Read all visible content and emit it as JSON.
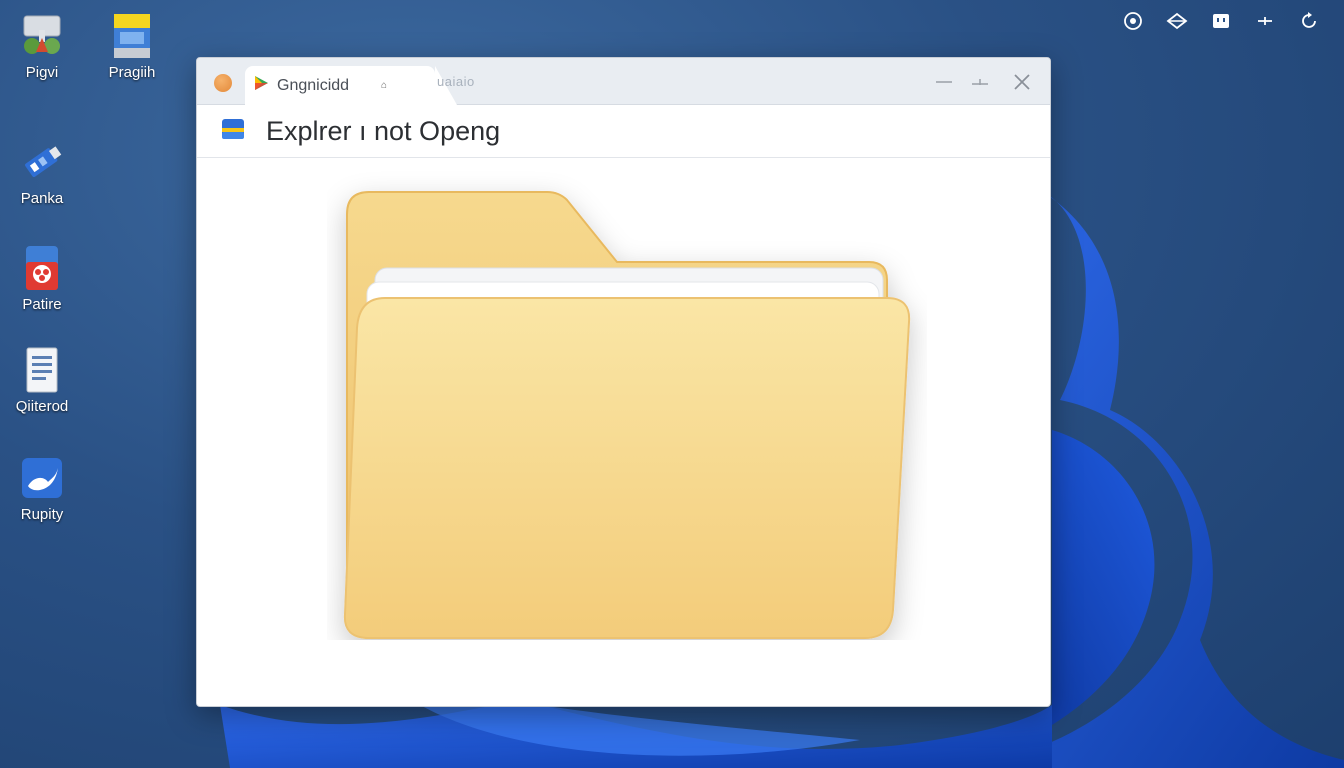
{
  "desktop": {
    "icons": [
      {
        "label": "Pigvi",
        "icon": "network-tree-icon"
      },
      {
        "label": "Pragiih",
        "icon": "app-window-icon"
      },
      {
        "label": "Panka",
        "icon": "usb-drive-icon"
      },
      {
        "label": "Patire",
        "icon": "red-app-icon"
      },
      {
        "label": "Qiiterod",
        "icon": "document-icon"
      },
      {
        "label": "Rupity",
        "icon": "blue-bird-app-icon"
      }
    ]
  },
  "tray": {
    "icons": [
      "eye-icon",
      "wifi-icon",
      "battery-icon",
      "brightness-icon",
      "refresh-icon"
    ]
  },
  "window": {
    "active_tab_title": "Gngnicidd",
    "active_tab_symbol": "⌂",
    "inactive_tab_title": "uaiaio",
    "title": "Explrer ı not Openg",
    "controls": {
      "minimize": "—",
      "maximize": "+",
      "close": "✕"
    }
  },
  "colors": {
    "folder_front": "#f7dd92",
    "folder_back": "#f3cf7c",
    "desktop_bg": "#2a5185",
    "swirl": "#1f55c8"
  }
}
